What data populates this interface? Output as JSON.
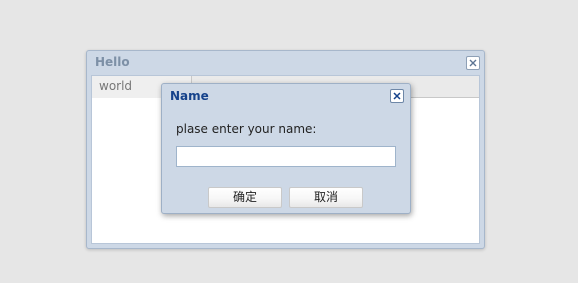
{
  "background_window": {
    "title": "Hello",
    "close_icon": "close-icon",
    "tab_label": "world"
  },
  "dialog": {
    "title": "Name",
    "close_icon": "close-icon",
    "prompt": "plase enter your name:",
    "input_value": "",
    "ok_label": "确定",
    "cancel_label": "取消"
  },
  "colors": {
    "page_background": "#e6e6e6",
    "window_frame": "#cdd8e6",
    "dialog_title": "#15428b",
    "window_title": "#7d90a6"
  }
}
